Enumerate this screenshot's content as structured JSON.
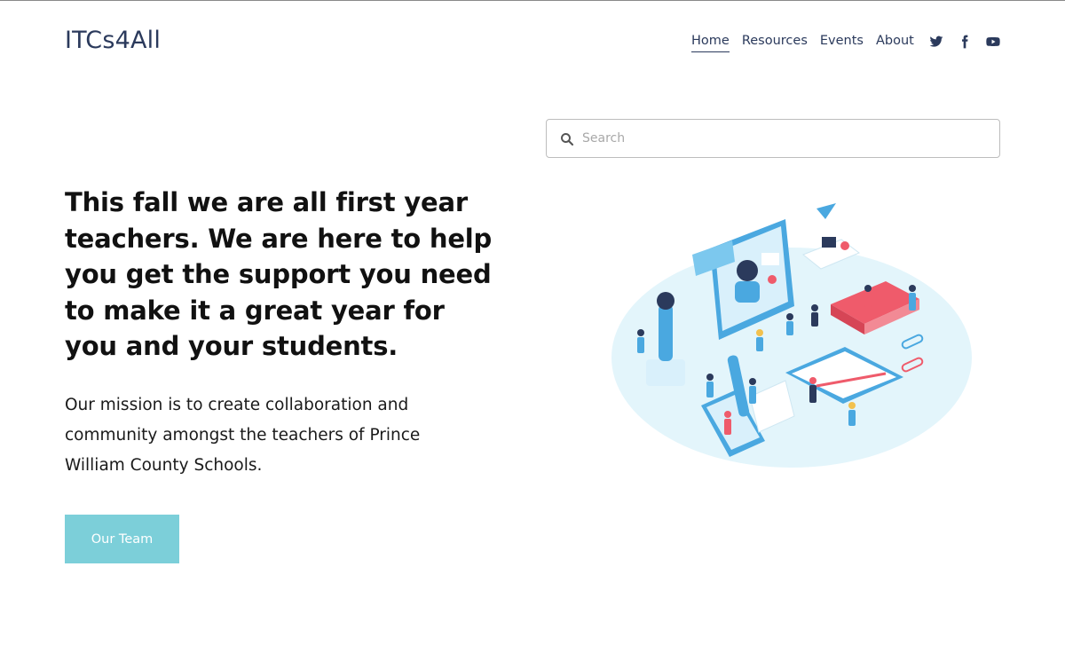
{
  "header": {
    "logo": "ITCs4All",
    "nav": [
      {
        "label": "Home",
        "active": true
      },
      {
        "label": "Resources",
        "active": false
      },
      {
        "label": "Events",
        "active": false
      },
      {
        "label": "About",
        "active": false
      }
    ],
    "social_icons": [
      "twitter-icon",
      "facebook-icon",
      "youtube-icon"
    ]
  },
  "search": {
    "placeholder": "Search",
    "icon": "search-icon"
  },
  "hero": {
    "headline": "This fall we are all first year teachers. We are here to help you get the support you need to make it a great year for you and your students.",
    "mission": "Our mission is to create collaboration and community amongst the teachers of Prince William County Schools.",
    "button_label": "Our Team"
  },
  "colors": {
    "brand_text": "#2b3a5c",
    "button_bg": "#7ccfd9",
    "illustration_ellipse": "#e3f5fb",
    "illustration_accent": "#4aa8e0",
    "illustration_red": "#ef5b6b"
  }
}
